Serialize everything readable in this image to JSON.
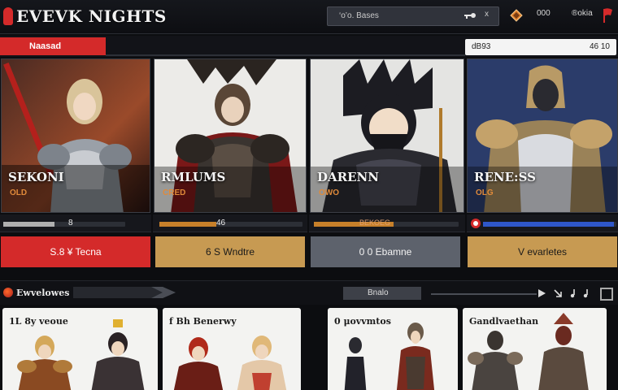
{
  "header": {
    "logo": "EVEVK NIGHTS",
    "search_text": "‘o’o. Bases",
    "search_close": "x",
    "right_label_1": "000",
    "right_label_2": "®okia"
  },
  "section": {
    "tab_label": "Naasad",
    "right_tab_left": "dB93",
    "right_tab_right": "46 10"
  },
  "heroes": [
    {
      "name": "SEKONI",
      "sub": "OLD",
      "strip_text": "8",
      "progress": 0.42,
      "bar_color": "#b0b0b0",
      "button": "S.8 ¥ Tecna",
      "button_style": "red"
    },
    {
      "name": "RMLUMS",
      "sub": "CRED",
      "strip_text": "46",
      "progress": 0.4,
      "bar_color": "#c7802a",
      "button": "6 S Wndtre",
      "button_style": "gold"
    },
    {
      "name": "DARENN",
      "sub": "OWO",
      "strip_text": "BEKOEG",
      "progress": 0.55,
      "bar_color": "#c7802a",
      "button": "0 0 Ebamne",
      "button_style": "grey"
    },
    {
      "name": "RENE:SS",
      "sub": "OLG",
      "strip_text": "",
      "progress": 0.98,
      "bar_color": "#2f57c9",
      "button": "V evarletes",
      "button_style": "gold"
    }
  ],
  "section2": {
    "title": "Ewvelowes",
    "pill": "Bnalo"
  },
  "roster": [
    {
      "title": "1L 8y veoue"
    },
    {
      "title": "f Bh Benerwy"
    },
    {
      "title": "0 μovvmtos"
    },
    {
      "title": "Gandlvaethan"
    }
  ],
  "colors": {
    "accent_red": "#d42a2a",
    "accent_gold": "#c79a52",
    "accent_blue": "#2f57c9",
    "accent_grey": "#5d626c"
  }
}
